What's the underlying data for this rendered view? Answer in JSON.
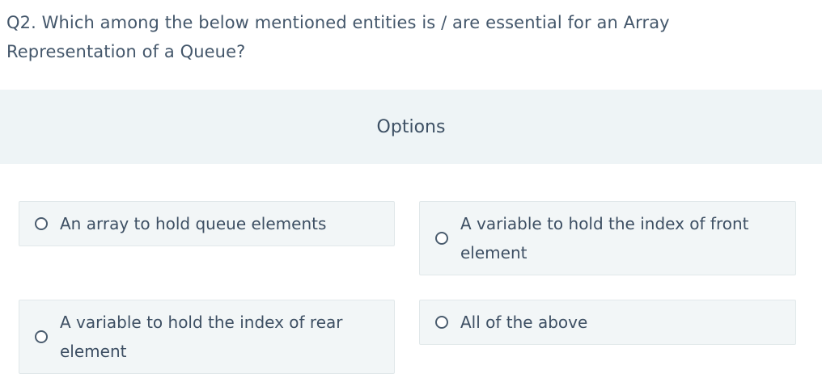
{
  "question": {
    "text": "Q2. Which among the below mentioned entities is / are essential for an Array Representation of a Queue?"
  },
  "options_header": {
    "title": "Options"
  },
  "options": [
    {
      "label": "An array to hold queue elements",
      "selected": false
    },
    {
      "label": "A variable to hold the index of front element",
      "selected": false
    },
    {
      "label": "A variable to hold the index of rear element",
      "selected": false
    },
    {
      "label": "All of the above",
      "selected": false
    }
  ],
  "colors": {
    "header_bg": "#eef4f6",
    "option_bg": "#f2f6f7",
    "text": "#3d4f63"
  }
}
